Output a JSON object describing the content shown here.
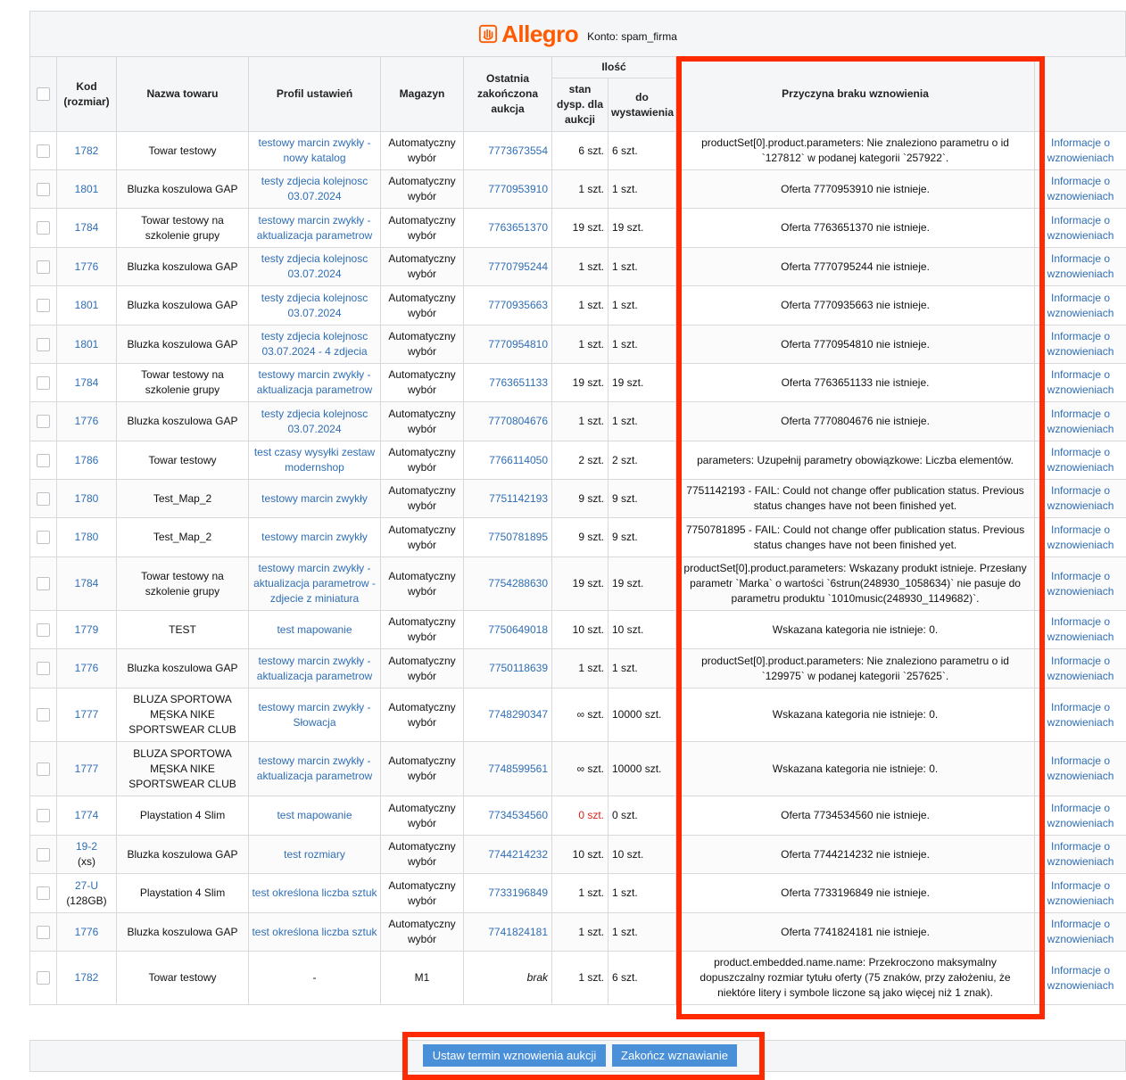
{
  "brand": {
    "logo_text": "Allegro",
    "account": "Konto: spam_firma",
    "color": "#ff5a00"
  },
  "headers": {
    "code": "Kod (rozmiar)",
    "name": "Nazwa towaru",
    "profile": "Profil ustawień",
    "warehouse": "Magazyn",
    "last_auction": "Ostatnia zakończona aukcja",
    "quantity": "Ilość",
    "available": "stan dysp. dla aukcji",
    "to_list": "do wystawienia",
    "reason": "Przyczyna braku wznowienia"
  },
  "rows": [
    {
      "code": "1782",
      "code2": "",
      "name": "Towar testowy",
      "profile": "testowy marcin zwykły - nowy katalog",
      "warehouse": "Automatyczny wybór",
      "auction": "7773673554",
      "avail": "6 szt.",
      "avail_red": false,
      "to_list": "6 szt.",
      "reason": "productSet[0].product.parameters: Nie znaleziono parametru o id `127812` w podanej kategorii `257922`.",
      "info": "Informacje o wznowieniach"
    },
    {
      "code": "1801",
      "code2": "",
      "name": "Bluzka koszulowa GAP",
      "profile": "testy zdjecia kolejnosc 03.07.2024",
      "warehouse": "Automatyczny wybór",
      "auction": "7770953910",
      "avail": "1 szt.",
      "avail_red": false,
      "to_list": "1 szt.",
      "reason": "Oferta 7770953910 nie istnieje.",
      "info": "Informacje o wznowieniach"
    },
    {
      "code": "1784",
      "code2": "",
      "name": "Towar testowy na szkolenie grupy",
      "profile": "testowy marcin zwykły - aktualizacja parametrow",
      "warehouse": "Automatyczny wybór",
      "auction": "7763651370",
      "avail": "19 szt.",
      "avail_red": false,
      "to_list": "19 szt.",
      "reason": "Oferta 7763651370 nie istnieje.",
      "info": "Informacje o wznowieniach"
    },
    {
      "code": "1776",
      "code2": "",
      "name": "Bluzka koszulowa GAP",
      "profile": "testy zdjecia kolejnosc 03.07.2024",
      "warehouse": "Automatyczny wybór",
      "auction": "7770795244",
      "avail": "1 szt.",
      "avail_red": false,
      "to_list": "1 szt.",
      "reason": "Oferta 7770795244 nie istnieje.",
      "info": "Informacje o wznowieniach"
    },
    {
      "code": "1801",
      "code2": "",
      "name": "Bluzka koszulowa GAP",
      "profile": "testy zdjecia kolejnosc 03.07.2024",
      "warehouse": "Automatyczny wybór",
      "auction": "7770935663",
      "avail": "1 szt.",
      "avail_red": false,
      "to_list": "1 szt.",
      "reason": "Oferta 7770935663 nie istnieje.",
      "info": "Informacje o wznowieniach"
    },
    {
      "code": "1801",
      "code2": "",
      "name": "Bluzka koszulowa GAP",
      "profile": "testy zdjecia kolejnosc 03.07.2024 - 4 zdjecia",
      "warehouse": "Automatyczny wybór",
      "auction": "7770954810",
      "avail": "1 szt.",
      "avail_red": false,
      "to_list": "1 szt.",
      "reason": "Oferta 7770954810 nie istnieje.",
      "info": "Informacje o wznowieniach"
    },
    {
      "code": "1784",
      "code2": "",
      "name": "Towar testowy na szkolenie grupy",
      "profile": "testowy marcin zwykły - aktualizacja parametrow",
      "warehouse": "Automatyczny wybór",
      "auction": "7763651133",
      "avail": "19 szt.",
      "avail_red": false,
      "to_list": "19 szt.",
      "reason": "Oferta 7763651133 nie istnieje.",
      "info": "Informacje o wznowieniach"
    },
    {
      "code": "1776",
      "code2": "",
      "name": "Bluzka koszulowa GAP",
      "profile": "testy zdjecia kolejnosc 03.07.2024",
      "warehouse": "Automatyczny wybór",
      "auction": "7770804676",
      "avail": "1 szt.",
      "avail_red": false,
      "to_list": "1 szt.",
      "reason": "Oferta 7770804676 nie istnieje.",
      "info": "Informacje o wznowieniach"
    },
    {
      "code": "1786",
      "code2": "",
      "name": "Towar testowy",
      "profile": "test czasy wysyłki zestaw modernshop",
      "warehouse": "Automatyczny wybór",
      "auction": "7766114050",
      "avail": "2 szt.",
      "avail_red": false,
      "to_list": "2 szt.",
      "reason": "parameters: Uzupełnij parametry obowiązkowe: Liczba elementów.",
      "info": "Informacje o wznowieniach"
    },
    {
      "code": "1780",
      "code2": "",
      "name": "Test_Map_2",
      "profile": "testowy marcin zwykły",
      "warehouse": "Automatyczny wybór",
      "auction": "7751142193",
      "avail": "9 szt.",
      "avail_red": false,
      "to_list": "9 szt.",
      "reason": "7751142193 - FAIL: Could not change offer publication status. Previous status changes have not been finished yet.",
      "info": "Informacje o wznowieniach"
    },
    {
      "code": "1780",
      "code2": "",
      "name": "Test_Map_2",
      "profile": "testowy marcin zwykły",
      "warehouse": "Automatyczny wybór",
      "auction": "7750781895",
      "avail": "9 szt.",
      "avail_red": false,
      "to_list": "9 szt.",
      "reason": "7750781895 - FAIL: Could not change offer publication status. Previous status changes have not been finished yet.",
      "info": "Informacje o wznowieniach"
    },
    {
      "code": "1784",
      "code2": "",
      "name": "Towar testowy na szkolenie grupy",
      "profile": "testowy marcin zwykły - aktualizacja parametrow - zdjecie z miniatura",
      "warehouse": "Automatyczny wybór",
      "auction": "7754288630",
      "avail": "19 szt.",
      "avail_red": false,
      "to_list": "19 szt.",
      "reason": "productSet[0].product.parameters: Wskazany produkt istnieje. Przesłany parametr `Marka` o wartości `6strun(248930_1058634)` nie pasuje do parametru produktu `1010music(248930_1149682)`.",
      "info": "Informacje o wznowieniach"
    },
    {
      "code": "1779",
      "code2": "",
      "name": "TEST",
      "profile": "test mapowanie",
      "warehouse": "Automatyczny wybór",
      "auction": "7750649018",
      "avail": "10 szt.",
      "avail_red": false,
      "to_list": "10 szt.",
      "reason": "Wskazana kategoria nie istnieje: 0.",
      "info": "Informacje o wznowieniach"
    },
    {
      "code": "1776",
      "code2": "",
      "name": "Bluzka koszulowa GAP",
      "profile": "testowy marcin zwykły - aktualizacja parametrow",
      "warehouse": "Automatyczny wybór",
      "auction": "7750118639",
      "avail": "1 szt.",
      "avail_red": false,
      "to_list": "1 szt.",
      "reason": "productSet[0].product.parameters: Nie znaleziono parametru o id `129975` w podanej kategorii `257625`.",
      "info": "Informacje o wznowieniach"
    },
    {
      "code": "1777",
      "code2": "",
      "name": "BLUZA SPORTOWA MĘSKA NIKE SPORTSWEAR CLUB",
      "profile": "testowy marcin zwykły - Słowacja",
      "warehouse": "Automatyczny wybór",
      "auction": "7748290347",
      "avail": "∞ szt.",
      "avail_red": false,
      "to_list": "10000 szt.",
      "reason": "Wskazana kategoria nie istnieje: 0.",
      "info": "Informacje o wznowieniach"
    },
    {
      "code": "1777",
      "code2": "",
      "name": "BLUZA SPORTOWA MĘSKA NIKE SPORTSWEAR CLUB",
      "profile": "testowy marcin zwykły - aktualizacja parametrow",
      "warehouse": "Automatyczny wybór",
      "auction": "7748599561",
      "avail": "∞ szt.",
      "avail_red": false,
      "to_list": "10000 szt.",
      "reason": "Wskazana kategoria nie istnieje: 0.",
      "info": "Informacje o wznowieniach"
    },
    {
      "code": "1774",
      "code2": "",
      "name": "Playstation 4 Slim",
      "profile": "test mapowanie",
      "warehouse": "Automatyczny wybór",
      "auction": "7734534560",
      "avail": "0 szt.",
      "avail_red": true,
      "to_list": "0 szt.",
      "reason": "Oferta 7734534560 nie istnieje.",
      "info": "Informacje o wznowieniach"
    },
    {
      "code": "19-2",
      "code2": "(xs)",
      "name": "Bluzka koszulowa GAP",
      "profile": "test rozmiary",
      "warehouse": "Automatyczny wybór",
      "auction": "7744214232",
      "avail": "10 szt.",
      "avail_red": false,
      "to_list": "10 szt.",
      "reason": "Oferta 7744214232 nie istnieje.",
      "info": "Informacje o wznowieniach"
    },
    {
      "code": "27-U",
      "code2": "(128GB)",
      "name": "Playstation 4 Slim",
      "profile": "test określona liczba sztuk",
      "warehouse": "Automatyczny wybór",
      "auction": "7733196849",
      "avail": "1 szt.",
      "avail_red": false,
      "to_list": "1 szt.",
      "reason": "Oferta 7733196849 nie istnieje.",
      "info": "Informacje o wznowieniach"
    },
    {
      "code": "1776",
      "code2": "",
      "name": "Bluzka koszulowa GAP",
      "profile": "test określona liczba sztuk",
      "warehouse": "Automatyczny wybór",
      "auction": "7741824181",
      "avail": "1 szt.",
      "avail_red": false,
      "to_list": "1 szt.",
      "reason": "Oferta 7741824181 nie istnieje.",
      "info": "Informacje o wznowieniach"
    },
    {
      "code": "1782",
      "code2": "",
      "name": "Towar testowy",
      "profile": "-",
      "profile_plain": true,
      "warehouse": "M1",
      "auction": "brak",
      "auction_plain": true,
      "avail": "1 szt.",
      "avail_red": false,
      "to_list": "6 szt.",
      "reason": "product.embedded.name.name: Przekroczono maksymalny dopuszczalny rozmiar tytułu oferty (75 znaków, przy założeniu, że niektóre litery i symbole liczone są jako więcej niż 1 znak).",
      "info": "Informacje o wznowieniach"
    }
  ],
  "footer": {
    "set_date_button": "Ustaw termin wznowienia aukcji",
    "finish_button": "Zakończ wznawianie"
  },
  "colors": {
    "link": "#2f6eb5",
    "highlight": "#ff2a00",
    "button": "#4a90d9",
    "warning": "#e0201b"
  }
}
